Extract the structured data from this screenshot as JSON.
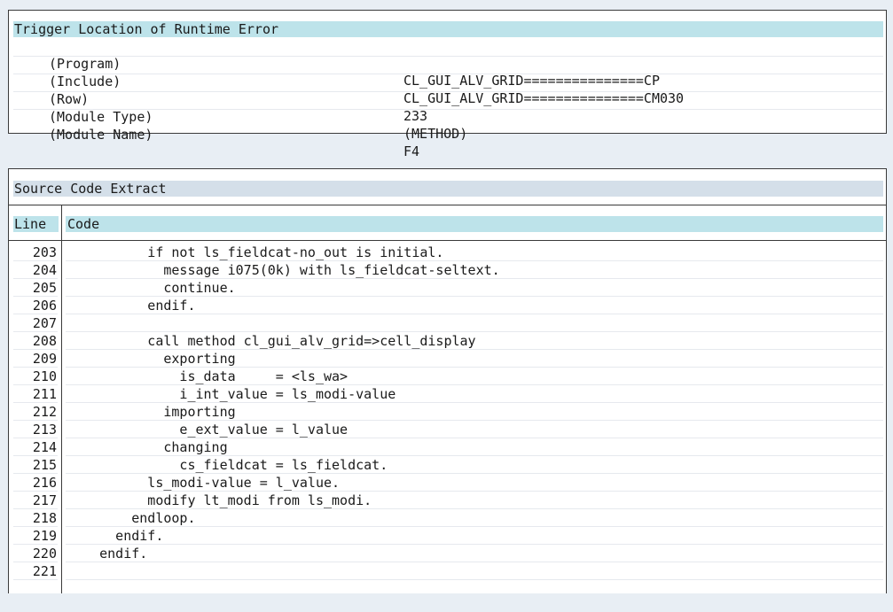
{
  "trigger": {
    "title": "Trigger Location of Runtime Error",
    "rows": [
      {
        "label": "(Program)",
        "value": "CL_GUI_ALV_GRID===============CP"
      },
      {
        "label": "(Include)",
        "value": "CL_GUI_ALV_GRID===============CM030"
      },
      {
        "label": "(Row)",
        "value": "233"
      },
      {
        "label": "(Module Type)",
        "value": "(METHOD)"
      },
      {
        "label": "(Module Name)",
        "value": "F4"
      }
    ]
  },
  "source": {
    "title": "Source Code Extract",
    "col_line": "Line",
    "col_code": "Code",
    "lines": [
      {
        "num": "203",
        "code": "          if not ls_fieldcat-no_out is initial."
      },
      {
        "num": "204",
        "code": "            message i075(0k) with ls_fieldcat-seltext."
      },
      {
        "num": "205",
        "code": "            continue."
      },
      {
        "num": "206",
        "code": "          endif."
      },
      {
        "num": "207",
        "code": ""
      },
      {
        "num": "208",
        "code": "          call method cl_gui_alv_grid=>cell_display"
      },
      {
        "num": "209",
        "code": "            exporting"
      },
      {
        "num": "210",
        "code": "              is_data     = <ls_wa>"
      },
      {
        "num": "211",
        "code": "              i_int_value = ls_modi-value"
      },
      {
        "num": "212",
        "code": "            importing"
      },
      {
        "num": "213",
        "code": "              e_ext_value = l_value"
      },
      {
        "num": "214",
        "code": "            changing"
      },
      {
        "num": "215",
        "code": "              cs_fieldcat = ls_fieldcat."
      },
      {
        "num": "216",
        "code": "          ls_modi-value = l_value."
      },
      {
        "num": "217",
        "code": "          modify lt_modi from ls_modi."
      },
      {
        "num": "218",
        "code": "        endloop."
      },
      {
        "num": "219",
        "code": "      endif."
      },
      {
        "num": "220",
        "code": "    endif."
      },
      {
        "num": "221",
        "code": ""
      }
    ]
  }
}
